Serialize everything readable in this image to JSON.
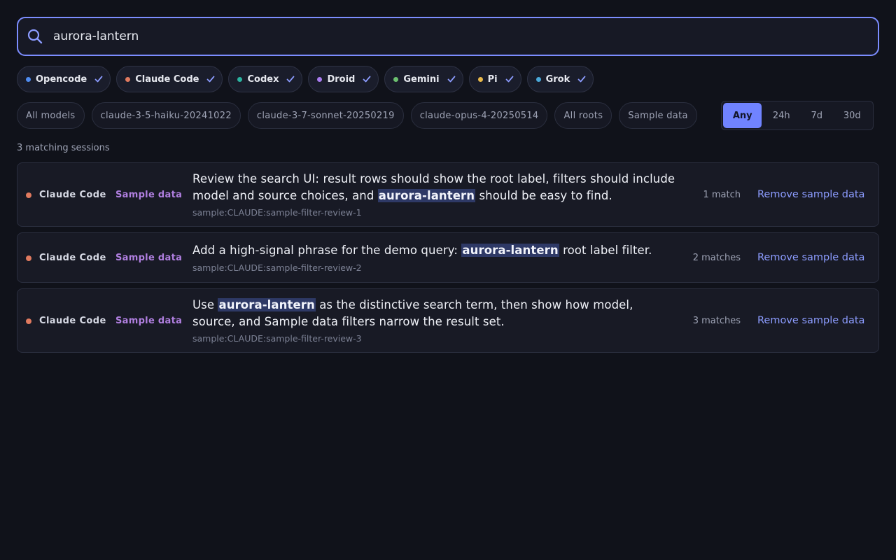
{
  "search": {
    "value": "aurora-lantern",
    "icon": "search-icon"
  },
  "sources": [
    {
      "label": "Opencode",
      "color": "#4f8cf0"
    },
    {
      "label": "Claude Code",
      "color": "#e07a5f"
    },
    {
      "label": "Codex",
      "color": "#2bb3a0"
    },
    {
      "label": "Droid",
      "color": "#a97cf0"
    },
    {
      "label": "Gemini",
      "color": "#6cc070"
    },
    {
      "label": "Pi",
      "color": "#e8b84a"
    },
    {
      "label": "Grok",
      "color": "#4aa8d8"
    }
  ],
  "filters": {
    "models": [
      "All models",
      "claude-3-5-haiku-20241022",
      "claude-3-7-sonnet-20250219",
      "claude-opus-4-20250514"
    ],
    "roots": [
      "All roots",
      "Sample data"
    ],
    "time_range": [
      "Any",
      "24h",
      "7d",
      "30d"
    ],
    "time_range_selected": "Any"
  },
  "results_count": "3 matching sessions",
  "results": [
    {
      "source": "Claude Code",
      "root": "Sample data",
      "text_before": "Review the search UI: result rows should show the root label, filters should include model and source choices, and ",
      "highlight": "aurora-lantern",
      "text_after": " should be easy to find.",
      "session_id": "sample:CLAUDE:sample-filter-review-1",
      "matches": "1 match",
      "action": "Remove sample data"
    },
    {
      "source": "Claude Code",
      "root": "Sample data",
      "text_before": "Add a high-signal phrase for the demo query: ",
      "highlight": "aurora-lantern",
      "text_after": " root label filter.",
      "session_id": "sample:CLAUDE:sample-filter-review-2",
      "matches": "2 matches",
      "action": "Remove sample data"
    },
    {
      "source": "Claude Code",
      "root": "Sample data",
      "text_before": "Use ",
      "highlight": "aurora-lantern",
      "text_after": " as the distinctive search term, then show how model, source, and Sample data filters narrow the result set.",
      "session_id": "sample:CLAUDE:sample-filter-review-3",
      "matches": "3 matches",
      "action": "Remove sample data"
    }
  ],
  "colors": {
    "accent": "#7083ff",
    "background": "#10121a",
    "highlight": "#2e3966",
    "root_label": "#b07fe0"
  }
}
